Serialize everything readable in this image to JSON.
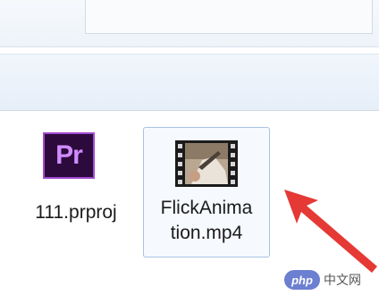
{
  "files": [
    {
      "name": "111.prproj",
      "icon": "premiere-pro-icon",
      "icon_text": "Pr",
      "selected": false
    },
    {
      "name_lines": [
        "FlickAnima",
        "tion.mp4"
      ],
      "icon": "video-file-icon",
      "selected": true
    }
  ],
  "watermark": {
    "logo": "php",
    "text": "中文网"
  },
  "colors": {
    "selection_border": "#a9c3e4",
    "arrow": "#e53935",
    "premiere": "#a14bd2"
  }
}
